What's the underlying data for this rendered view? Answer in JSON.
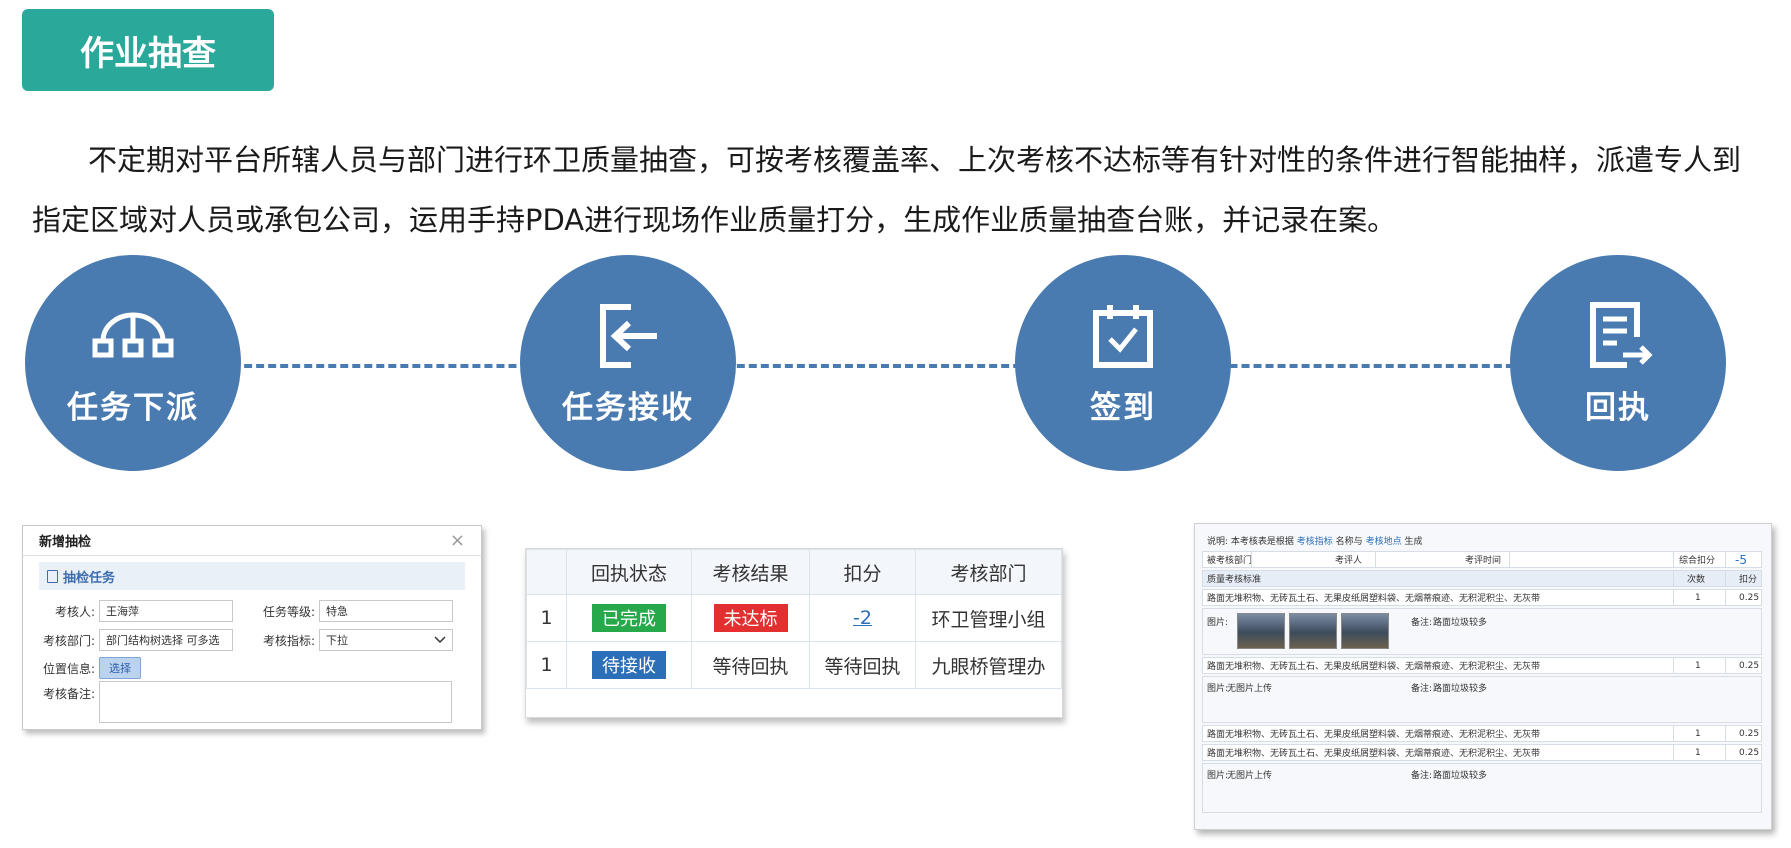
{
  "header": {
    "title": "作业抽查",
    "intro": "不定期对平台所辖人员与部门进行环卫质量抽查，可按考核覆盖率、上次考核不达标等有针对性的条件进行智能抽样，派遣专人到指定区域对人员或承包公司，运用手持PDA进行现场作业质量打分，生成作业质量抽查台账，并记录在案。"
  },
  "flow": {
    "steps": [
      {
        "label": "任务下派",
        "icon": "dispatch-icon"
      },
      {
        "label": "任务接收",
        "icon": "receive-icon"
      },
      {
        "label": "签到",
        "icon": "calendar-check-icon"
      },
      {
        "label": "回执",
        "icon": "receipt-icon"
      }
    ],
    "accent": "#4a7bb0"
  },
  "dialog": {
    "title": "新增抽检",
    "close": "×",
    "section": "抽检任务",
    "assessor_label": "考核人:",
    "assessor_value": "王海萍",
    "level_label": "任务等级:",
    "level_value": "特急",
    "dept_label": "考核部门:",
    "dept_value": "部门结构树选择 可多选",
    "indicator_label": "考核指标:",
    "indicator_value": "下拉",
    "location_label": "位置信息:",
    "location_button": "选择",
    "remark_label": "考核备注:"
  },
  "table": {
    "headers": [
      "",
      "回执状态",
      "考核结果",
      "扣分",
      "考核部门"
    ],
    "rows": [
      {
        "idx": "1",
        "status": "已完成",
        "result": "未达标",
        "score": "-2",
        "dept": "环卫管理小组"
      },
      {
        "idx": "1",
        "status": "待接收",
        "result": "等待回执",
        "score": "等待回执",
        "dept": "九眼桥管理办"
      }
    ],
    "colors": {
      "done": "#27a84a",
      "fail": "#e23030",
      "pending": "#2b6fb8"
    }
  },
  "sheet": {
    "note_prefix": "说明: 本考核表是根据",
    "note_link1": "考核指标",
    "note_mid": "名称与",
    "note_link2": "考核地点",
    "note_suffix": "生成",
    "dept_label": "被考核部门",
    "assessor_label": "考评人",
    "time_label": "考评时间",
    "total_label": "综合扣分",
    "total_value": "-5",
    "standard_label": "质量考核标准",
    "count_label": "次数",
    "deduct_label": "扣分",
    "item_text": "路面无堆积物、无砖瓦土石、无果皮纸屑塑料袋、无烟蒂痕迹、无积泥积尘、无灰带",
    "item_count": "1",
    "item_deduct": "0.25",
    "photo_label": "图片:",
    "no_photo": "无图片上传",
    "remark_label": "备注:",
    "remark_value": "路面垃圾较多"
  }
}
